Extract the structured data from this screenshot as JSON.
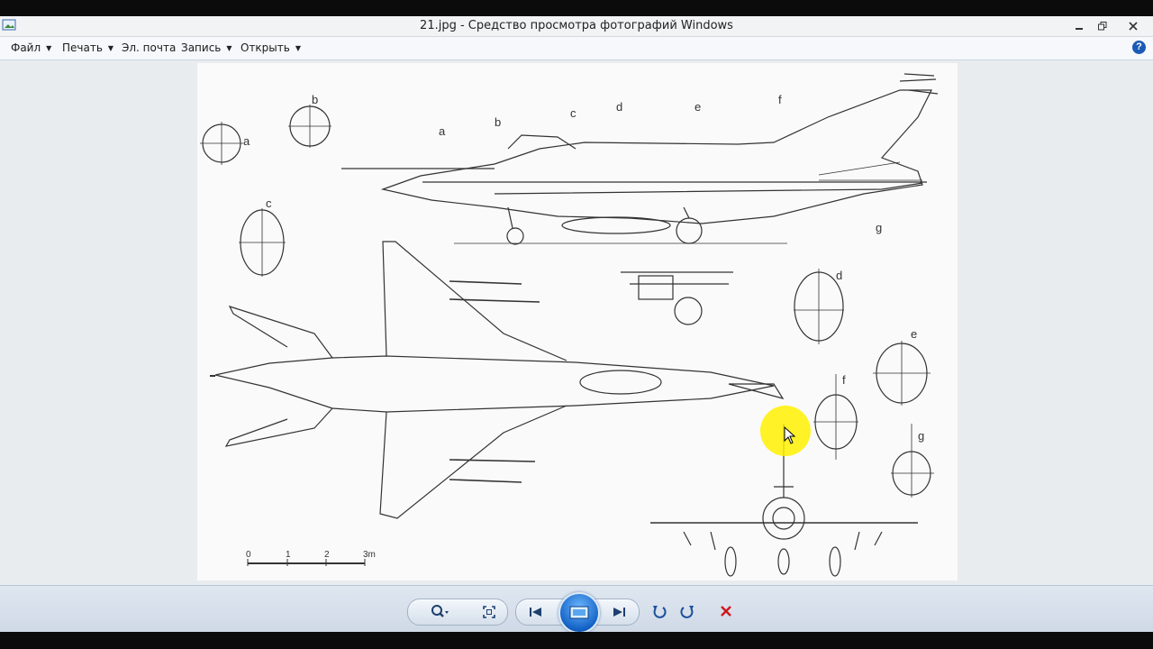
{
  "window": {
    "title": "21.jpg - Средство просмотра фотографий Windows"
  },
  "menu": {
    "items": [
      {
        "label": "Файл",
        "dropdown": true
      },
      {
        "label": "Печать",
        "dropdown": true
      },
      {
        "label": "Эл. почта",
        "dropdown": false
      },
      {
        "label": "Запись",
        "dropdown": true
      },
      {
        "label": "Открыть",
        "dropdown": true
      }
    ],
    "help_icon": "help-icon"
  },
  "drawing": {
    "section_labels": [
      "a",
      "b",
      "c",
      "d",
      "e",
      "f",
      "g"
    ],
    "scale": {
      "ticks": [
        "0",
        "1",
        "2",
        "3m"
      ]
    }
  },
  "controls": {
    "icons": [
      "zoom-icon",
      "fit-window-icon",
      "previous-icon",
      "slideshow-icon",
      "next-icon",
      "rotate-left-icon",
      "rotate-right-icon",
      "delete-icon"
    ]
  },
  "colors": {
    "accent": "#1463c6",
    "delete": "#d0161b",
    "cursor_highlight": "#fff000"
  }
}
